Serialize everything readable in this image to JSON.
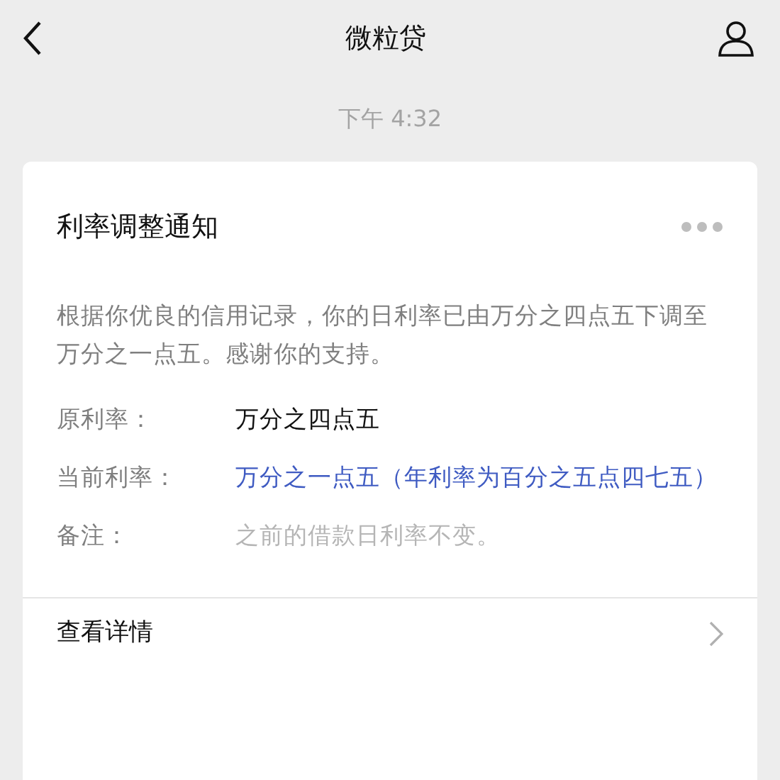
{
  "header": {
    "title": "微粒贷"
  },
  "timestamp": "下午 4:32",
  "card": {
    "title": "利率调整通知",
    "message": "根据你优良的信用记录，你的日利率已由万分之四点五下调至万分之一点五。感谢你的支持。",
    "rows": [
      {
        "label": "原利率：",
        "value": "万分之四点五",
        "kind": "normal"
      },
      {
        "label": "当前利率：",
        "value": "万分之一点五（年利率为百分之五点四七五）",
        "kind": "highlight"
      },
      {
        "label": "备注：",
        "value": "之前的借款日利率不变。",
        "kind": "muted"
      }
    ],
    "footer_link": "查看详情"
  }
}
